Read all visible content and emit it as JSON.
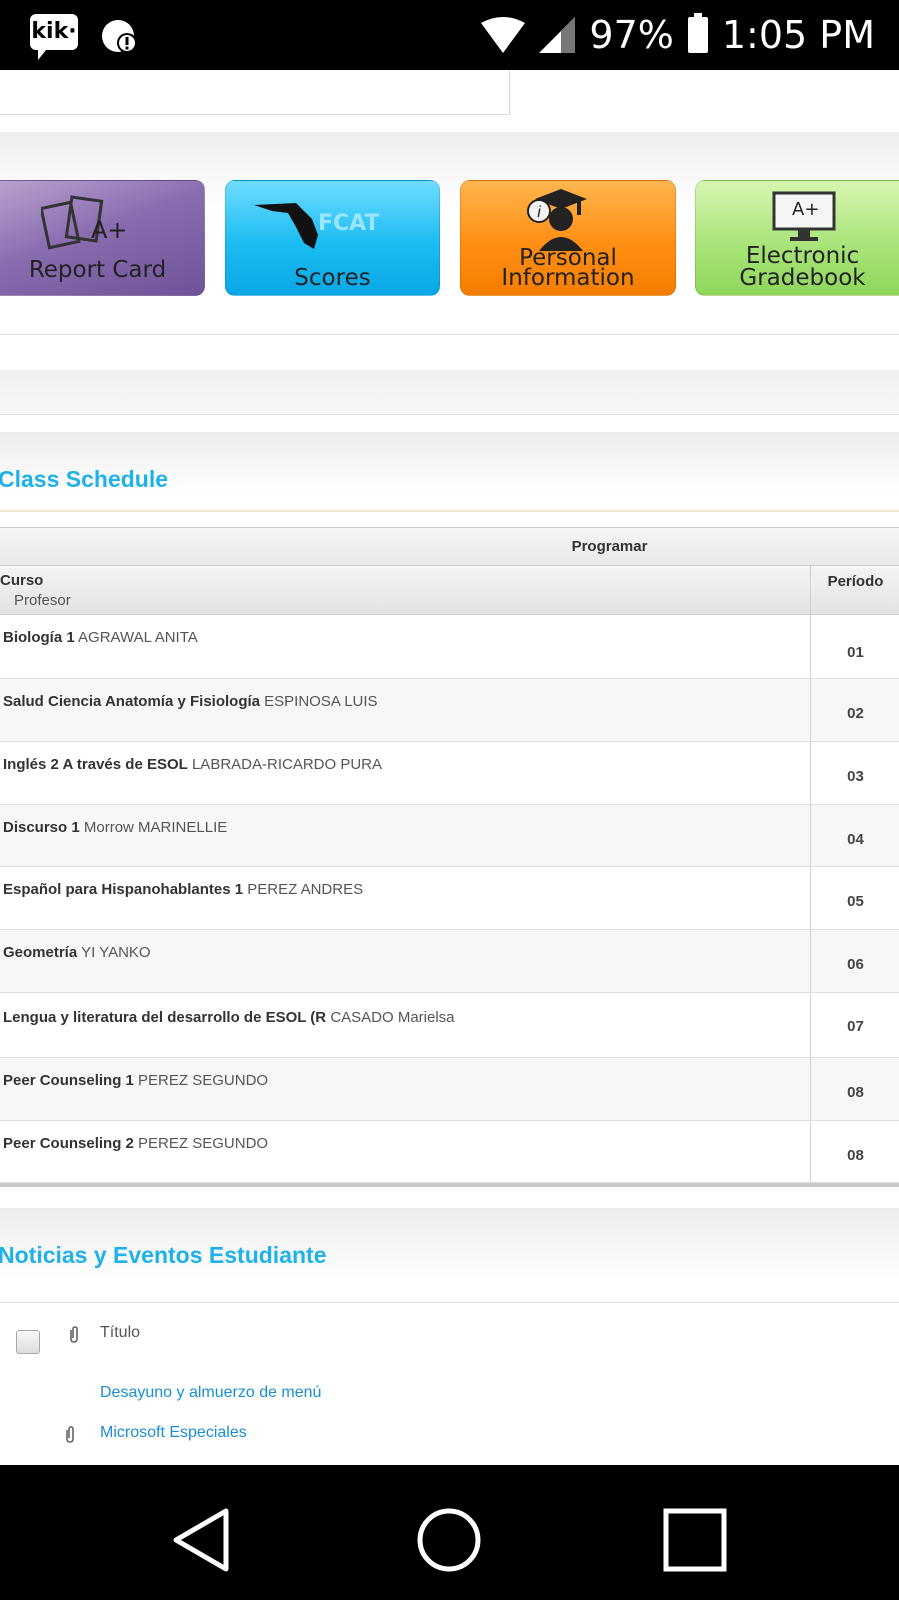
{
  "status_bar": {
    "kik_label": "kik·",
    "battery": "97%",
    "time": "1:05 PM"
  },
  "tiles": [
    {
      "label_line1": "",
      "label_line2": "Report Card",
      "icon": "report-card-icon",
      "badge": "A+"
    },
    {
      "label_line1": "",
      "label_line2": "Scores",
      "icon": "florida-map-icon",
      "badge": "FCAT"
    },
    {
      "label_line1": "Personal",
      "label_line2": "Information",
      "icon": "graduate-info-icon"
    },
    {
      "label_line1": "Electronic",
      "label_line2": "Gradebook",
      "icon": "monitor-grade-icon",
      "badge": "A+"
    }
  ],
  "class_schedule": {
    "title": "Class Schedule",
    "caption": "Programar",
    "col_course": "Curso",
    "col_teacher": "Profesor",
    "col_period": "Período",
    "rows": [
      {
        "course": "Biología 1",
        "teacher": "AGRAWAL ANITA",
        "period": "01"
      },
      {
        "course": "Salud Ciencia Anatomía y Fisiología",
        "teacher": "ESPINOSA LUIS",
        "period": "02"
      },
      {
        "course": "Inglés 2 A través de ESOL",
        "teacher": "LABRADA-RICARDO PURA",
        "period": "03"
      },
      {
        "course": "Discurso 1",
        "teacher": "Morrow MARINELLIE",
        "period": "04"
      },
      {
        "course": "Español para Hispanohablantes 1",
        "teacher": "PEREZ ANDRES",
        "period": "05"
      },
      {
        "course": "Geometría",
        "teacher": "YI YANKO",
        "period": "06"
      },
      {
        "course": "Lengua y literatura del desarrollo de ESOL (R",
        "teacher": "CASADO Marielsa",
        "period": "07"
      },
      {
        "course": "Peer Counseling 1",
        "teacher": "PEREZ SEGUNDO",
        "period": "08"
      },
      {
        "course": "Peer Counseling 2",
        "teacher": "PEREZ SEGUNDO",
        "period": "08"
      }
    ]
  },
  "news": {
    "title": "Noticias y Eventos Estudiante",
    "col_title": "Título",
    "items": [
      {
        "label": "Desayuno y almuerzo de menú",
        "has_attachment": false
      },
      {
        "label": "Microsoft Especiales",
        "has_attachment": true
      }
    ]
  }
}
